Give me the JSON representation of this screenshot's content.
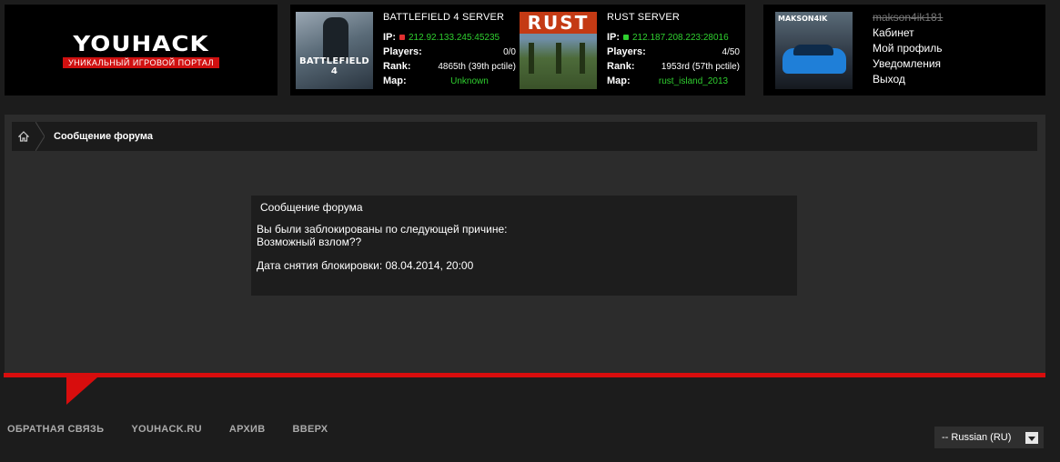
{
  "logo": {
    "title": "YOUHACK",
    "subtitle": "УНИКАЛЬНЫЙ ИГРОВОЙ ПОРТАЛ"
  },
  "servers": [
    {
      "image_caption": "BATTLEFIELD 4",
      "title": "BATTLEFIELD 4 SERVER",
      "ip_label": "IP:",
      "ip": "212.92.133.245:45235",
      "status_color": "#e03030",
      "players_label": "Players:",
      "players": "0/0",
      "rank_label": "Rank:",
      "rank": "4865th (39th pctile)",
      "map_label": "Map:",
      "map": "Unknown"
    },
    {
      "image_caption": "RUST",
      "title": "RUST SERVER",
      "ip_label": "IP:",
      "ip": "212.187.208.223:28016",
      "status_color": "#2fcf2f",
      "players_label": "Players:",
      "players": "4/50",
      "rank_label": "Rank:",
      "rank": "1953rd (57th pctile)",
      "map_label": "Map:",
      "map": "rust_island_2013"
    }
  ],
  "user": {
    "avatar_caption": "MAKSON4IK",
    "username": "makson4ik181",
    "menu": [
      "Кабинет",
      "Мой профиль",
      "Уведомления",
      "Выход"
    ]
  },
  "breadcrumb": {
    "current": "Сообщение форума"
  },
  "message": {
    "title": "Сообщение форума",
    "line1": "Вы были заблокированы по следующей причине:",
    "line2": "Возможный взлом??",
    "line3": "Дата снятия блокировки: 08.04.2014, 20:00"
  },
  "footer": {
    "links": [
      "ОБРАТНАЯ СВЯЗЬ",
      "YOUHACK.RU",
      "АРХИВ",
      "ВВЕРХ"
    ],
    "language": "-- Russian (RU)"
  },
  "colors": {
    "accent": "#d80d0d",
    "status_green": "#2fcf2f"
  }
}
